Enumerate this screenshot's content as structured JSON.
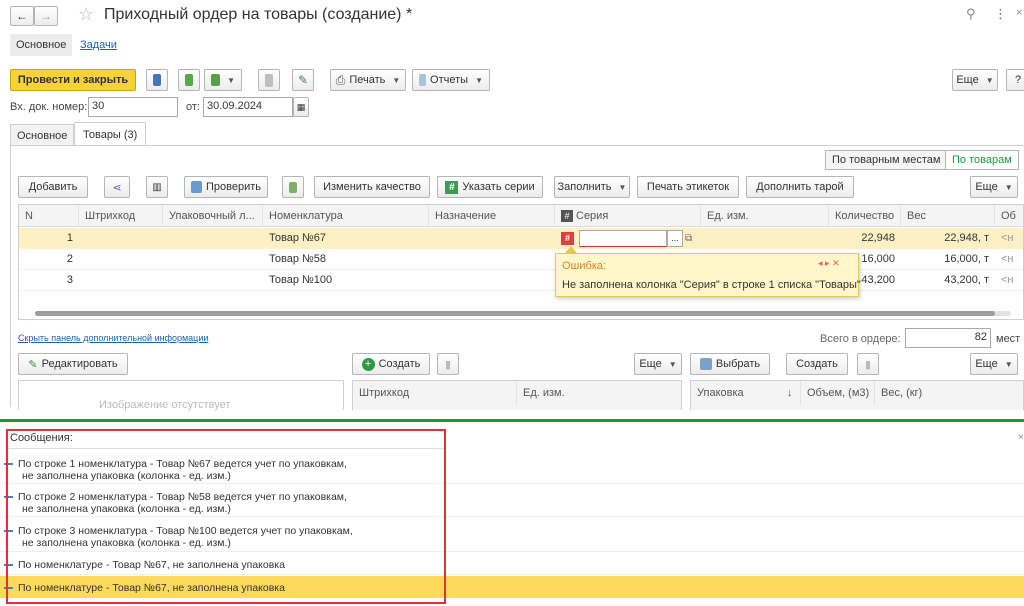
{
  "window": {
    "title": "Приходный ордер на товары (создание) *"
  },
  "nav": {
    "main": "Основное",
    "tasks": "Задачи"
  },
  "toolbar": {
    "post_close": "Провести и закрыть",
    "print": "Печать",
    "reports": "Отчеты",
    "more": "Еще",
    "help": "?"
  },
  "header": {
    "doc_num_label": "Вх. док. номер:",
    "doc_num": "30",
    "date_label": "от:",
    "date": "30.09.2024"
  },
  "tabs": [
    {
      "label": "Основное"
    },
    {
      "label": "Товары (3)"
    }
  ],
  "toggle": {
    "by_places": "По товарным местам",
    "by_goods": "По товарам"
  },
  "goods_toolbar": {
    "add": "Добавить",
    "check": "Проверить",
    "change_quality": "Изменить качество",
    "set_series": "Указать серии",
    "fill": "Заполнить",
    "print_labels": "Печать этикеток",
    "add_tare": "Дополнить тарой",
    "more": "Еще"
  },
  "grid": {
    "headers": [
      "N",
      "Штрихкод",
      "Упаковочный л...",
      "Номенклатура",
      "Назначение",
      "Серия",
      "Ед. изм.",
      "Количество",
      "Вес",
      "Об"
    ],
    "rows": [
      {
        "n": "1",
        "item": "Товар №67",
        "qty": "22,948",
        "weight": "22,948, т",
        "vol": "<н"
      },
      {
        "n": "2",
        "item": "Товар №58",
        "qty": "16,000",
        "weight": "16,000, т",
        "vol": "<н"
      },
      {
        "n": "3",
        "item": "Товар №100",
        "qty": "43,200",
        "weight": "43,200, т",
        "vol": "<н"
      }
    ]
  },
  "tooltip": {
    "title": "Ошибка:",
    "text": "Не заполнена колонка \"Серия\" в строке 1 списка \"Товары\""
  },
  "footer": {
    "hide_panel": "Скрыть панель дополнительной информации",
    "total_label": "Всего в ордере:",
    "total": "82",
    "unit": "мест"
  },
  "bottom": {
    "edit": "Редактировать",
    "create": "Создать",
    "more": "Еще",
    "choose": "Выбрать",
    "create2": "Создать",
    "more2": "Еще",
    "col_barcode": "Штрихкод",
    "col_unit": "Ед. изм.",
    "col_pack": "Упаковка",
    "col_volume": "Объем, (м3)",
    "col_weight": "Вес, (кг)",
    "placeholder": "Изображение отсутствует"
  },
  "messages": {
    "title": "Сообщения:",
    "items": [
      {
        "line1": "По строке 1 номенклатура - Товар №67 ведется учет по упаковкам,",
        "line2": "не заполнена упаковка (колонка - ед. изм.)"
      },
      {
        "line1": "По строке 2 номенклатура - Товар №58 ведется учет по упаковкам,",
        "line2": "не заполнена упаковка (колонка - ед. изм.)"
      },
      {
        "line1": "По строке 3 номенклатура - Товар №100 ведется учет по упаковкам,",
        "line2": "не заполнена упаковка (колонка - ед. изм.)"
      },
      {
        "line1": "По номенклатуре - Товар №67, не заполнена упаковка",
        "line2": ""
      },
      {
        "line1": "По номенклатуре - Товар №67, не заполнена упаковка",
        "line2": ""
      }
    ]
  },
  "colors": {
    "accent_yellow": "#f5d23a",
    "selected_row": "#fcf0c4",
    "error_red": "#d93333",
    "green_line": "#1a9a3c",
    "link": "#1f5fb0"
  }
}
